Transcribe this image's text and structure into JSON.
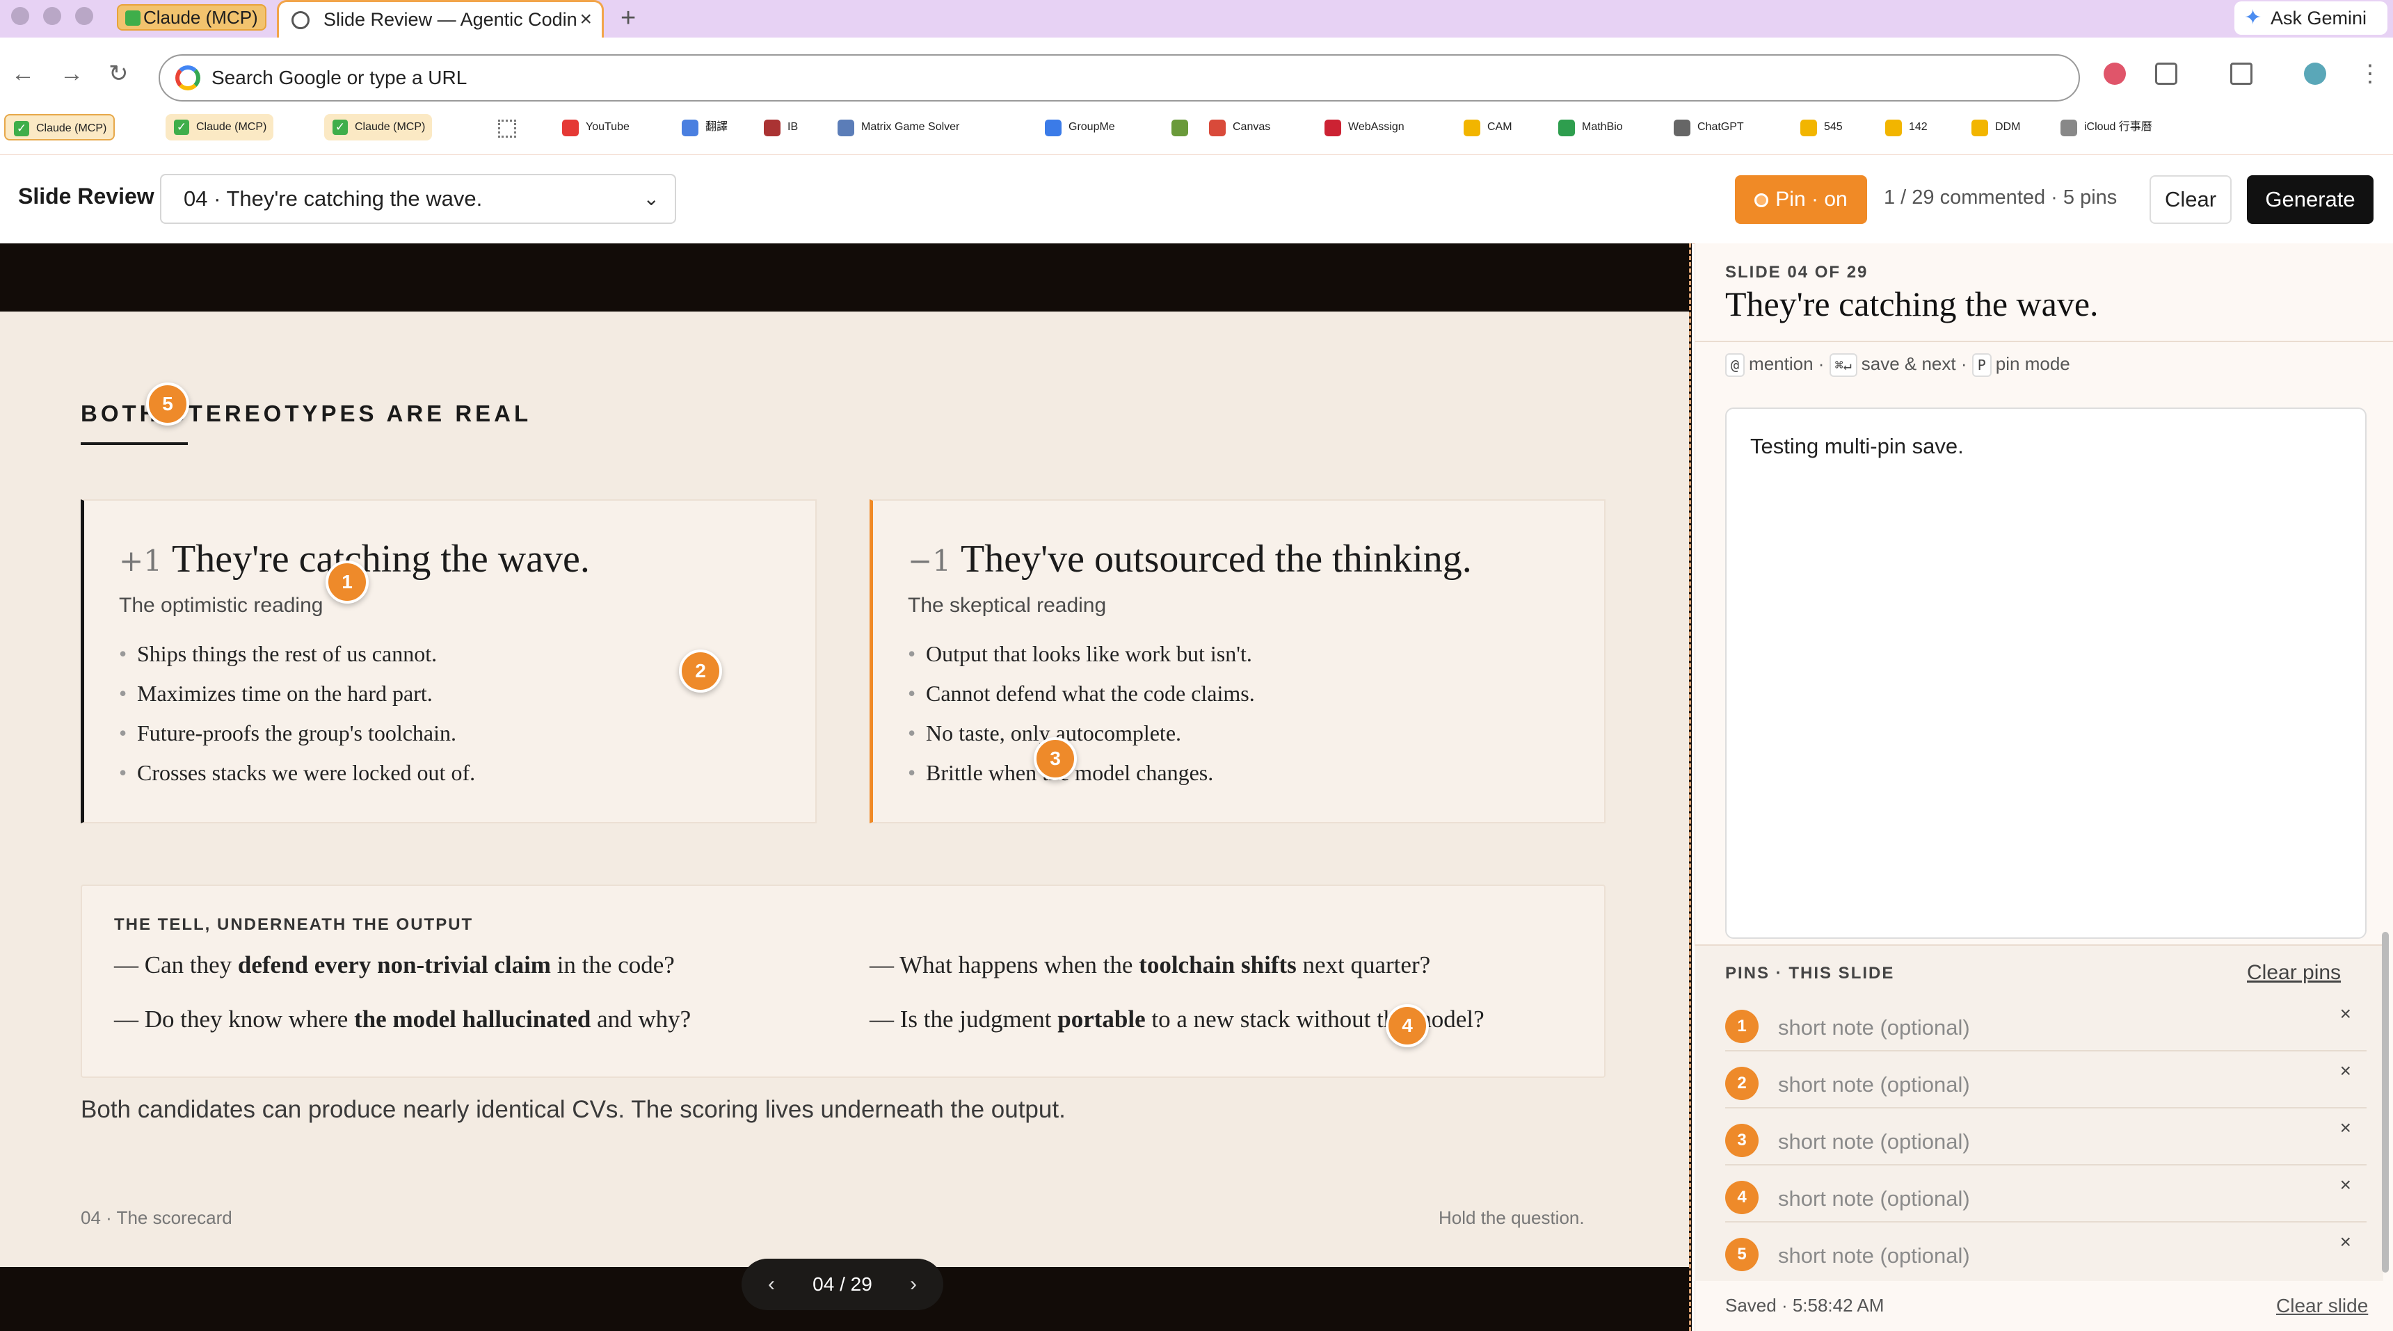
{
  "browser": {
    "pinned_tab_label": "Claude (MCP)",
    "active_tab_title": "Slide Review — Agentic Codin",
    "tab_close": "×",
    "new_tab": "+",
    "ask_gemini": "Ask Gemini",
    "omnibox_placeholder": "Search Google or type a URL",
    "nav": {
      "back": "←",
      "forward": "→",
      "reload": "↻"
    }
  },
  "bookmarks": [
    {
      "label": "Claude (MCP)",
      "icon": "check-icon"
    },
    {
      "label": "Claude (MCP)",
      "icon": "check-icon"
    },
    {
      "label": "Claude (MCP)",
      "icon": "check-icon"
    },
    {
      "label": "YouTube",
      "icon": "youtube-icon",
      "color": "#e53935"
    },
    {
      "label": "翻譯",
      "icon": "translate-icon",
      "color": "#4a7fe0"
    },
    {
      "label": "IB",
      "icon": "ib-icon",
      "color": "#a33"
    },
    {
      "label": "Matrix Game Solver",
      "icon": "matrix-icon",
      "color": "#5b7db8"
    },
    {
      "label": "GroupMe",
      "icon": "groupme-icon",
      "color": "#3b7be8"
    },
    {
      "label": "",
      "icon": "sigma-icon",
      "color": "#6a9a3a"
    },
    {
      "label": "Canvas",
      "icon": "canvas-icon",
      "color": "#d94a3a"
    },
    {
      "label": "WebAssign",
      "icon": "webassign-icon",
      "color": "#c23"
    },
    {
      "label": "CAM",
      "icon": "drive-icon",
      "color": "#f2b500"
    },
    {
      "label": "MathBio",
      "icon": "sheets-icon",
      "color": "#2e9e4e"
    },
    {
      "label": "ChatGPT",
      "icon": "chatgpt-icon",
      "color": "#666"
    },
    {
      "label": "545",
      "icon": "drive-icon",
      "color": "#f2b500"
    },
    {
      "label": "142",
      "icon": "drive-icon",
      "color": "#f2b500"
    },
    {
      "label": "DDM",
      "icon": "drive-icon",
      "color": "#f2b500"
    },
    {
      "label": "iCloud 行事曆",
      "icon": "apple-icon",
      "color": "#888"
    }
  ],
  "app": {
    "title": "Slide Review",
    "slide_select_value": "04 · They're catching the wave.",
    "pin_button": "Pin · on",
    "comment_status": "1 / 29 commented · 5 pins",
    "clear_button": "Clear",
    "generate_button": "Generate",
    "accent": "#f08a26"
  },
  "slide": {
    "kicker": "BOTH STEREOTYPES ARE REAL",
    "card_plus": {
      "sign": "+1",
      "headline": "They're catching the wave.",
      "subhead": "The optimistic reading",
      "bullets": [
        "Ships things the rest of us cannot.",
        "Maximizes time on the hard part.",
        "Future-proofs the group's toolchain.",
        "Crosses stacks we were locked out of."
      ]
    },
    "card_minus": {
      "sign": "−1",
      "headline": "They've outsourced the thinking.",
      "subhead": "The skeptical reading",
      "bullets": [
        "Output that looks like work but isn't.",
        "Cannot defend what the code claims.",
        "No taste, only autocomplete.",
        "Brittle when the model changes."
      ]
    },
    "tell": {
      "label": "THE TELL, UNDERNEATH THE OUTPUT",
      "q1": {
        "pre": "— Can they ",
        "bold": "defend every non-trivial claim",
        "post": " in the code?"
      },
      "q2": {
        "pre": "— What happens when the ",
        "bold": "toolchain shifts",
        "post": " next quarter?"
      },
      "q3": {
        "pre": "— Do they know where ",
        "bold": "the model hallucinated",
        "post": " and why?"
      },
      "q4": {
        "pre": "— Is the judgment ",
        "bold": "portable",
        "post": " to a new stack without the model?"
      }
    },
    "footnote": "Both candidates can produce nearly identical CVs. The scoring lives underneath the output.",
    "footer_left": "04 · The scorecard",
    "footer_right": "Hold the question.",
    "pager": {
      "prev": "‹",
      "current": "04 / 29",
      "next": "›"
    },
    "pins": [
      "1",
      "2",
      "3",
      "4",
      "5"
    ]
  },
  "panel": {
    "eyebrow": "SLIDE 04 OF 29",
    "title": "They're catching the wave.",
    "shortcuts": {
      "k1": "@",
      "t1": "mention ·",
      "k2": "⌘↵",
      "t2": "save & next ·",
      "k3": "P",
      "t3": "pin mode"
    },
    "note_text": "Testing multi-pin save.",
    "pins_label": "PINS · THIS SLIDE",
    "clear_pins": "Clear pins",
    "pin_rows": [
      {
        "num": "1",
        "placeholder": "short note (optional)"
      },
      {
        "num": "2",
        "placeholder": "short note (optional)"
      },
      {
        "num": "3",
        "placeholder": "short note (optional)"
      },
      {
        "num": "4",
        "placeholder": "short note (optional)"
      },
      {
        "num": "5",
        "placeholder": "short note (optional)"
      }
    ],
    "remove": "×",
    "saved": "Saved · 5:58:42 AM",
    "clear_slide": "Clear slide"
  }
}
